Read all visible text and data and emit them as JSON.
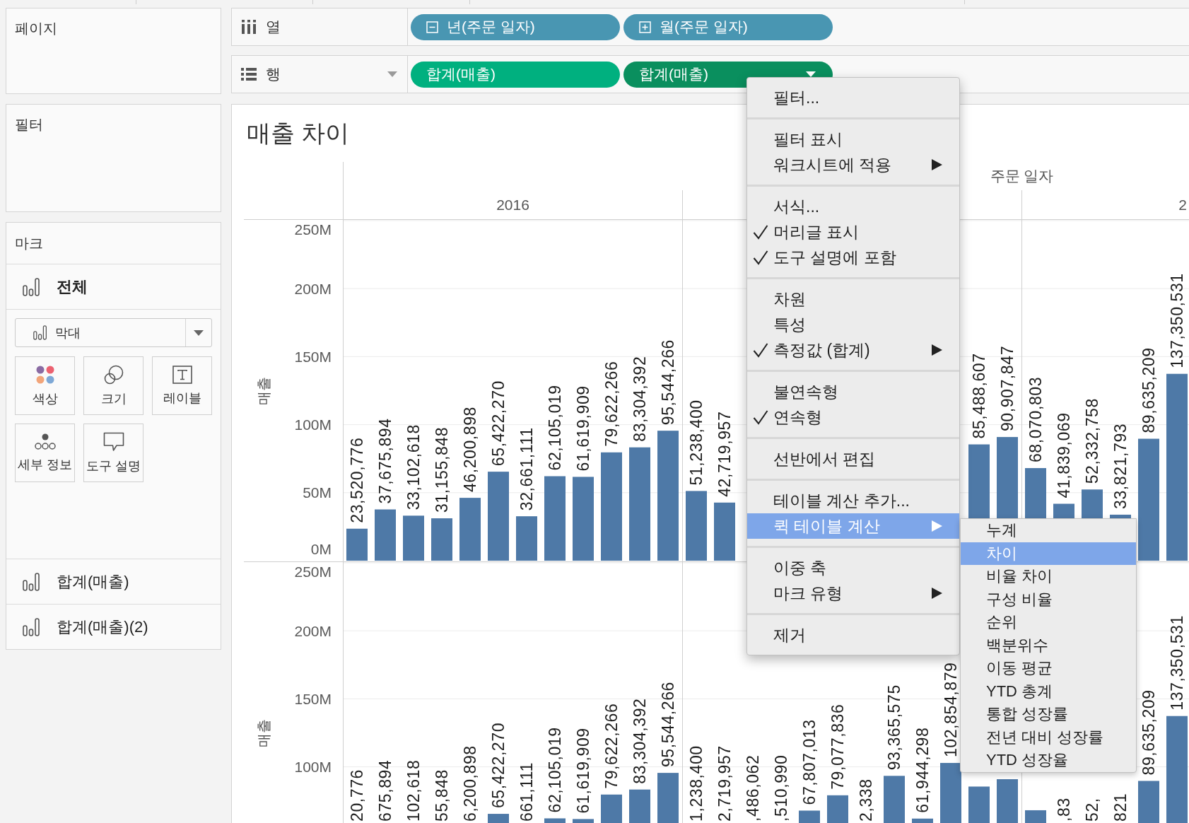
{
  "sidebar": {
    "pages": {
      "title": "페이지"
    },
    "filters": {
      "title": "필터"
    },
    "marks": {
      "title": "마크",
      "all": {
        "label": "전체",
        "mark_type": "막대",
        "properties": [
          {
            "label": "색상",
            "kind": "color"
          },
          {
            "label": "크기",
            "kind": "size"
          },
          {
            "label": "레이블",
            "kind": "label"
          },
          {
            "label": "세부 정보",
            "kind": "detail"
          },
          {
            "label": "도구 설명",
            "kind": "tooltip"
          }
        ]
      },
      "layers": [
        {
          "label": "합계(매출)"
        },
        {
          "label": "합계(매출)(2)"
        }
      ]
    }
  },
  "shelves": [
    {
      "kind": "columns",
      "label": "열",
      "dropdown": false,
      "pills": [
        {
          "label": "년(주문 일자)",
          "kind": "discrete",
          "expanded": true,
          "selected": false
        },
        {
          "label": "월(주문 일자)",
          "kind": "discrete",
          "expanded": false,
          "selected": false
        }
      ]
    },
    {
      "kind": "rows",
      "label": "행",
      "dropdown": true,
      "pills": [
        {
          "label": "합계(매출)",
          "kind": "continuous",
          "selected": false
        },
        {
          "label": "합계(매출)",
          "kind": "continuous",
          "selected": true
        }
      ]
    }
  ],
  "view": {
    "title": "매출 차이",
    "year_headers": [
      "2016",
      "2"
    ],
    "rows": [
      {
        "chart_data": {
          "type": "bar",
          "xlabel": "주문 일자",
          "ylabel": "매출",
          "ylim": [
            0,
            250000000
          ],
          "grid": true,
          "yticks": [
            {
              "value": 0,
              "label": "0M"
            },
            {
              "value": 50000000,
              "label": "50M"
            },
            {
              "value": 100000000,
              "label": "100M"
            },
            {
              "value": 150000000,
              "label": "150M"
            },
            {
              "value": 200000000,
              "label": "200M"
            },
            {
              "value": 250000000,
              "label": "250M"
            }
          ],
          "categories": [
            null,
            null,
            null,
            null,
            null,
            null,
            null,
            null,
            null,
            null,
            null,
            null,
            null,
            null,
            null,
            null,
            null,
            null,
            null,
            null,
            null,
            null,
            null,
            null,
            null,
            null,
            null,
            null,
            null,
            null
          ],
          "values": [
            23520776,
            37675894,
            33102618,
            31155848,
            46200898,
            65422270,
            32661111,
            62105019,
            61619909,
            79622266,
            83304392,
            95544266,
            51238400,
            42719957,
            null,
            null,
            null,
            null,
            null,
            null,
            null,
            null,
            85488607,
            90907847,
            68070803,
            41839069,
            52332758,
            33821793,
            89635209,
            137350531
          ],
          "value_labels": [
            "23,520,776",
            "37,675,894",
            "33,102,618",
            "31,155,848",
            "46,200,898",
            "65,422,270",
            "32,661,111",
            "62,105,019",
            "61,619,909",
            "79,622,266",
            "83,304,392",
            "95,544,266",
            "51,238,400",
            "42,719,957",
            null,
            null,
            null,
            null,
            null,
            null,
            null,
            null,
            "85,488,607",
            "90,907,847",
            "68,070,803",
            "41,839,069",
            "52,332,758",
            "33,821,793",
            "89,635,209",
            "137,350,531"
          ]
        }
      },
      {
        "chart_data": {
          "type": "bar",
          "ylabel": "매출",
          "ylim": [
            58700000,
            250000000
          ],
          "grid": true,
          "yticks": [
            {
              "value": 100000000,
              "label": "100M"
            },
            {
              "value": 150000000,
              "label": "150M"
            },
            {
              "value": 200000000,
              "label": "200M"
            },
            {
              "value": 250000000,
              "label": "250M"
            }
          ],
          "categories": [
            null,
            null,
            null,
            null,
            null,
            null,
            null,
            null,
            null,
            null,
            null,
            null,
            null,
            null,
            null,
            null,
            null,
            null,
            null,
            null,
            null,
            null,
            null,
            null,
            null,
            null,
            null,
            null,
            null,
            null
          ],
          "values": [
            null,
            null,
            null,
            null,
            null,
            65422270,
            null,
            62105019,
            61619909,
            79622266,
            83304392,
            95544266,
            null,
            null,
            null,
            null,
            67807013,
            79077836,
            null,
            93365575,
            61944298,
            102854879,
            85488607,
            90907847,
            68070803,
            null,
            null,
            null,
            89635209,
            137350531
          ],
          "value_labels": [
            "20,776",
            "675,894",
            "102,618",
            "55,848",
            "6,200,898",
            "65,422,270",
            "661,111",
            "62,105,019",
            "61,619,909",
            "79,622,266",
            "83,304,392",
            "95,544,266",
            "1,238,400",
            "2,719,957",
            ",486,062",
            ",510,990",
            "67,807,013",
            "79,077,836",
            "2,338",
            "93,365,575",
            "61,944,298",
            "102,854,879",
            null,
            null,
            null,
            ",83",
            "52,",
            "821",
            "89,635,209",
            "137,350,531"
          ]
        }
      }
    ]
  },
  "context_menu": {
    "sections": [
      {
        "items": [
          {
            "label": "필터...",
            "checked": false,
            "submenu": false,
            "selected": false
          }
        ]
      },
      {
        "items": [
          {
            "label": "필터 표시",
            "checked": false,
            "submenu": false,
            "selected": false
          },
          {
            "label": "워크시트에 적용",
            "checked": false,
            "submenu": true,
            "selected": false
          }
        ]
      },
      {
        "items": [
          {
            "label": "서식...",
            "checked": false,
            "submenu": false,
            "selected": false
          },
          {
            "label": "머리글 표시",
            "checked": true,
            "submenu": false,
            "selected": false
          },
          {
            "label": "도구 설명에 포함",
            "checked": true,
            "submenu": false,
            "selected": false
          }
        ]
      },
      {
        "items": [
          {
            "label": "차원",
            "checked": false,
            "submenu": false,
            "selected": false
          },
          {
            "label": "특성",
            "checked": false,
            "submenu": false,
            "selected": false
          },
          {
            "label": "측정값 (합계)",
            "checked": true,
            "submenu": true,
            "selected": false
          }
        ]
      },
      {
        "items": [
          {
            "label": "불연속형",
            "checked": false,
            "submenu": false,
            "selected": false
          },
          {
            "label": "연속형",
            "checked": true,
            "submenu": false,
            "selected": false
          }
        ]
      },
      {
        "items": [
          {
            "label": "선반에서 편집",
            "checked": false,
            "submenu": false,
            "selected": false
          }
        ]
      },
      {
        "items": [
          {
            "label": "테이블 계산 추가...",
            "checked": false,
            "submenu": false,
            "selected": false
          },
          {
            "label": "퀵 테이블 계산",
            "checked": false,
            "submenu": true,
            "selected": true
          }
        ]
      },
      {
        "items": [
          {
            "label": "이중 축",
            "checked": false,
            "submenu": false,
            "selected": false
          },
          {
            "label": "마크 유형",
            "checked": false,
            "submenu": true,
            "selected": false
          }
        ]
      },
      {
        "items": [
          {
            "label": "제거",
            "checked": false,
            "submenu": false,
            "selected": false
          }
        ]
      }
    ]
  },
  "submenu": {
    "items": [
      {
        "label": "누계",
        "selected": false
      },
      {
        "label": "차이",
        "selected": true
      },
      {
        "label": "비율 차이",
        "selected": false
      },
      {
        "label": "구성 비율",
        "selected": false
      },
      {
        "label": "순위",
        "selected": false
      },
      {
        "label": "백분위수",
        "selected": false
      },
      {
        "label": "이동 평균",
        "selected": false
      },
      {
        "label": "YTD 총계",
        "selected": false
      },
      {
        "label": "통합 성장률",
        "selected": false
      },
      {
        "label": "전년 대비 성장률",
        "selected": false
      },
      {
        "label": "YTD 성장율",
        "selected": false
      }
    ]
  }
}
